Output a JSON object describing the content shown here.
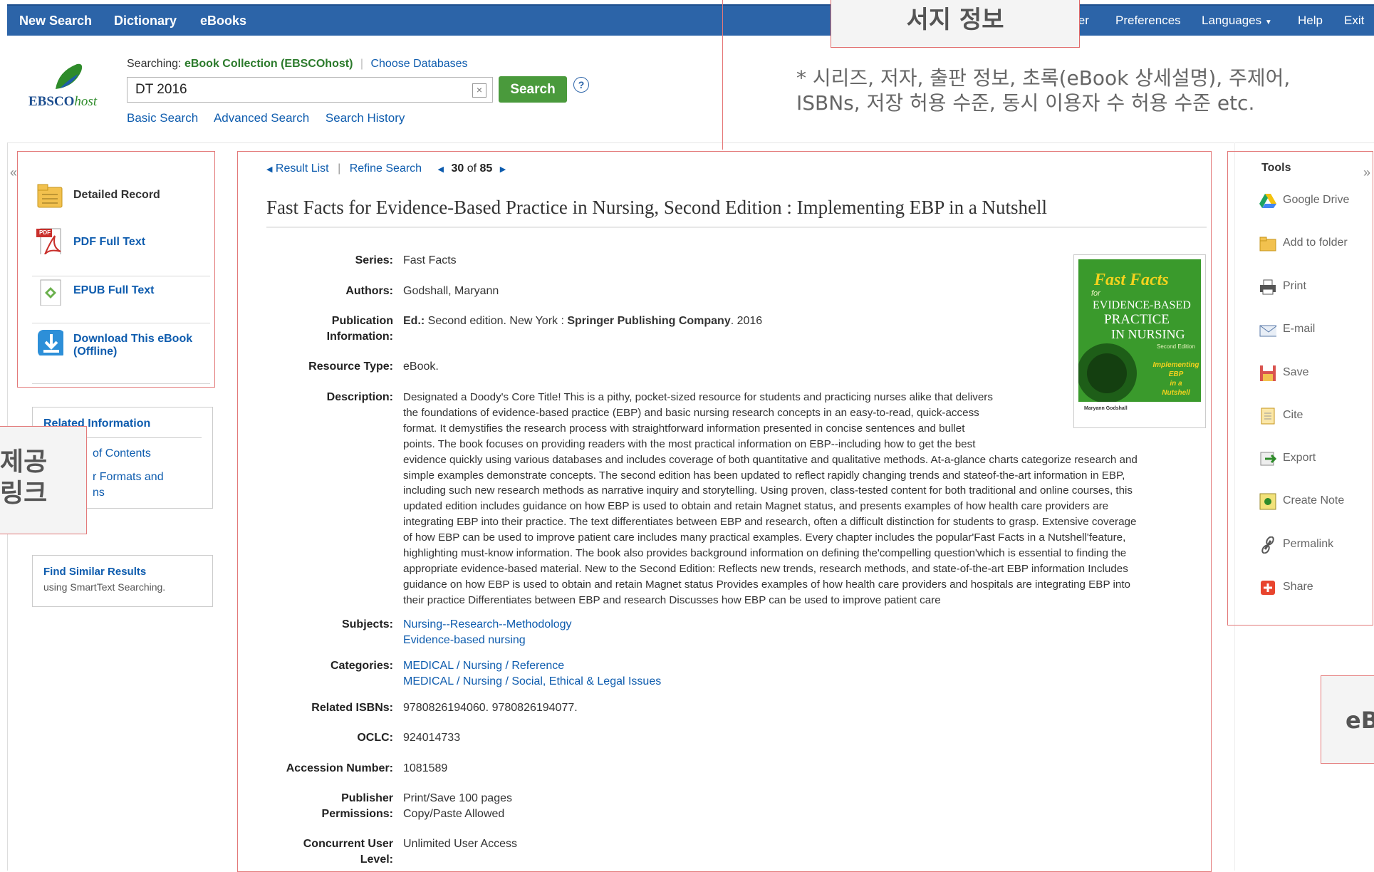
{
  "topnav": {
    "left": [
      "New Search",
      "Dictionary",
      "eBooks"
    ],
    "right": [
      "ler",
      "Preferences",
      "Languages",
      "Help",
      "Exit"
    ]
  },
  "annotations": {
    "title_box": "서지 정보",
    "description_line1": "* 시리즈, 저자, 출판 정보, 초록(eBook 상세설명), 주제어,",
    "description_line2": "ISBNs, 저장 허용 수준, 동시 이용자 수 허용 수준 etc.",
    "left_box_line1": "제공",
    "left_box_line2": "링크",
    "right_box": "eB"
  },
  "header": {
    "logo_text": "EBSCO",
    "logo_suffix": "host",
    "searching_label": "Searching:",
    "searching_db": "eBook Collection (EBSCOhost)",
    "choose_databases": "Choose Databases",
    "search_value": "DT 2016",
    "clear_label": "×",
    "search_button": "Search",
    "help_label": "?",
    "links": [
      "Basic Search",
      "Advanced Search",
      "Search History"
    ]
  },
  "left_panel": {
    "items": [
      "Detailed Record",
      "PDF Full Text",
      "EPUB Full Text",
      "Download This eBook",
      "(Offline)"
    ],
    "pdf_badge": "PDF",
    "related_heading": "Related Information",
    "related_links": [
      "of Contents",
      "r Formats and",
      "ns"
    ],
    "similar_title": "Find Similar Results",
    "similar_sub": "using SmartText Searching."
  },
  "result_nav": {
    "result_list": "Result List",
    "refine": "Refine Search",
    "current": "30",
    "of": "of",
    "total": "85"
  },
  "record": {
    "title": "Fast Facts for Evidence-Based Practice in Nursing, Second Edition : Implementing EBP in a Nutshell",
    "labels": {
      "series": "Series:",
      "authors": "Authors:",
      "publication_1": "Publication",
      "publication_2": "Information:",
      "resource_type": "Resource Type:",
      "description": "Description:",
      "subjects": "Subjects:",
      "categories": "Categories:",
      "isbns": "Related ISBNs:",
      "oclc": "OCLC:",
      "accession": "Accession Number:",
      "permissions_1": "Publisher",
      "permissions_2": "Permissions:",
      "concurrent_1": "Concurrent User",
      "concurrent_2": "Level:"
    },
    "series": "Fast Facts",
    "authors": "Godshall, Maryann",
    "publication_ed_label": "Ed.:",
    "publication_pre": "Second edition. New York :",
    "publication_publisher": "Springer Publishing Company",
    "publication_year": ". 2016",
    "resource_type": "eBook.",
    "description_lines": [
      "Designated a Doody's Core Title! This is a pithy, pocket-sized resource for students and practicing nurses alike that delivers",
      "the foundations of evidence-based practice (EBP) and basic nursing research concepts in an easy-to-read, quick-access",
      "format. It demystifies the research process with straightforward information presented in concise sentences and bullet",
      "points. The book focuses on providing readers with the most practical information on EBP--including how to get the best",
      "evidence quickly using various databases and includes coverage of both quantitative and qualitative methods. At-a-glance charts categorize research and",
      "simple examples demonstrate concepts. The second edition has been updated to reflect rapidly changing trends and stateof-the-art information in EBP,",
      "including such new research methods as narrative inquiry and storytelling. Using proven, class-tested content for both traditional and online courses, this",
      "updated edition includes guidance on how EBP is used to obtain and retain Magnet status, and presents examples of how health care providers are",
      "integrating EBP into their practice. The text differentiates between EBP and research, often a difficult distinction for students to grasp. Extensive coverage",
      "of how EBP can be used to improve patient care includes many practical examples. Every chapter includes the popular'Fast Facts in a Nutshell'feature,",
      "highlighting must-know information. The book also provides background information on defining the'compelling question'which is essential to finding the",
      "appropriate evidence-based material. New to the Second Edition: Reflects new trends, research methods, and state-of-the-art EBP information Includes",
      "guidance on how EBP is used to obtain and retain Magnet status Provides examples of how health care providers and hospitals are integrating EBP into",
      "their practice Differentiates between EBP and research Discusses how EBP can be used to improve patient care"
    ],
    "subjects": [
      "Nursing--Research--Methodology",
      "Evidence-based nursing"
    ],
    "categories": [
      "MEDICAL / Nursing / Reference",
      "MEDICAL / Nursing / Social, Ethical & Legal Issues"
    ],
    "isbns": "9780826194060. 9780826194077.",
    "oclc": "924014733",
    "accession": "1081589",
    "permissions": [
      "Print/Save 100 pages",
      "Copy/Paste Allowed"
    ],
    "concurrent": "Unlimited User Access",
    "cover": {
      "title_1": "Fast Facts",
      "title_2": "for",
      "title_3": "EVIDENCE-BASED",
      "title_4": "PRACTICE",
      "title_5": "IN NURSING",
      "edition": "Second Edition",
      "sub_1": "Implementing",
      "sub_2": "EBP",
      "sub_3": "in a",
      "sub_4": "Nutshell",
      "author": "Maryann Godshall"
    }
  },
  "tools": {
    "heading": "Tools",
    "items": [
      "Google Drive",
      "Add to folder",
      "Print",
      "E-mail",
      "Save",
      "Cite",
      "Export",
      "Create Note",
      "Permalink",
      "Share"
    ]
  },
  "colors": {
    "topbar": "#2c64a8",
    "search_button": "#4a9a3c",
    "link": "#0e5cae",
    "annotation_border": "#e37a7a"
  }
}
